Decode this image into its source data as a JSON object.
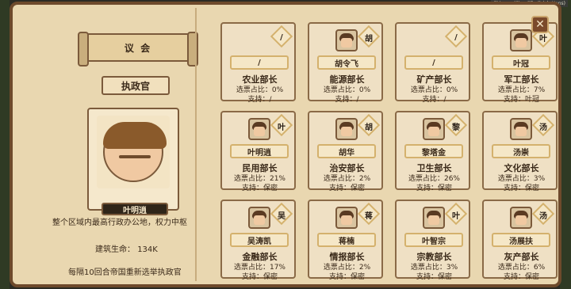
{
  "top_badge": "Chinese (Simplified) (zh-Hans)",
  "parliament": {
    "title": "议 会",
    "executive": {
      "title": "执政官",
      "name": "叶明逍",
      "description": "整个区域内最高行政办公地，权力中枢",
      "building_life_label": "建筑生命：",
      "building_life_value": "134K",
      "election_note": "每隔10回合帝国重新选举执政官"
    }
  },
  "cards": [
    {
      "badge": "/",
      "name": "/",
      "role": "农业部长",
      "vote": "选票占比：0%",
      "support": "支持：/",
      "avatar": false
    },
    {
      "badge": "胡",
      "name": "胡令飞",
      "role": "能源部长",
      "vote": "选票占比：0%",
      "support": "支持：/",
      "avatar": true
    },
    {
      "badge": "/",
      "name": "/",
      "role": "矿产部长",
      "vote": "选票占比：0%",
      "support": "支持：/",
      "avatar": false
    },
    {
      "badge": "叶",
      "name": "叶冠",
      "role": "军工部长",
      "vote": "选票占比：7%",
      "support": "支持：叶冠",
      "avatar": true
    },
    {
      "badge": "叶",
      "name": "叶明逍",
      "role": "民用部长",
      "vote": "选票占比：21%",
      "support": "支持：保密",
      "avatar": true
    },
    {
      "badge": "胡",
      "name": "胡华",
      "role": "治安部长",
      "vote": "选票占比：2%",
      "support": "支持：保密",
      "avatar": true
    },
    {
      "badge": "黎",
      "name": "黎塔金",
      "role": "卫生部长",
      "vote": "选票占比：26%",
      "support": "支持：保密",
      "avatar": true
    },
    {
      "badge": "汤",
      "name": "汤崇",
      "role": "文化部长",
      "vote": "选票占比：3%",
      "support": "支持：保密",
      "avatar": true
    },
    {
      "badge": "吴",
      "name": "吴涛凯",
      "role": "金融部长",
      "vote": "选票占比：17%",
      "support": "支持：保密",
      "avatar": true
    },
    {
      "badge": "蒋",
      "name": "蒋楠",
      "role": "情报部长",
      "vote": "选票占比：2%",
      "support": "支持：保密",
      "avatar": true
    },
    {
      "badge": "叶",
      "name": "叶智宗",
      "role": "宗教部长",
      "vote": "选票占比：3%",
      "support": "支持：保密",
      "avatar": true
    },
    {
      "badge": "汤",
      "name": "汤展扶",
      "role": "灰产部长",
      "vote": "选票占比：6%",
      "support": "支持：保密",
      "avatar": true
    }
  ],
  "close_icon": "close-icon"
}
